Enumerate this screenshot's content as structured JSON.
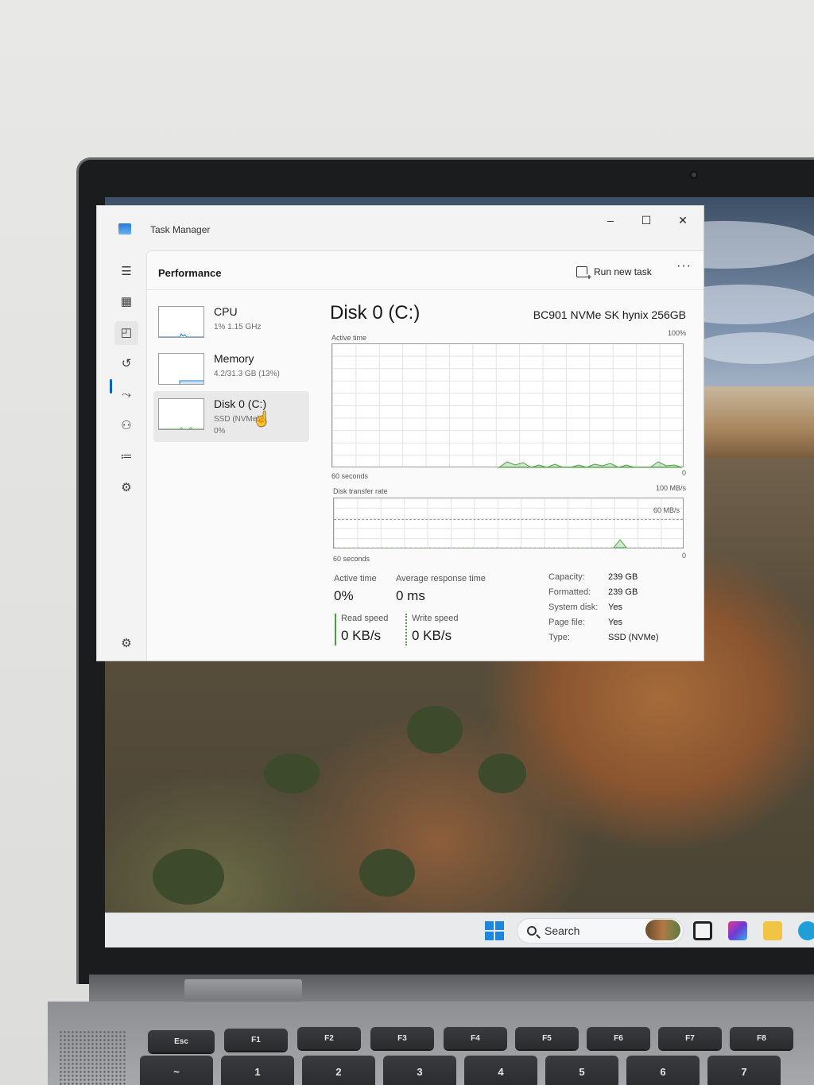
{
  "window": {
    "title": "Task Manager",
    "minimize": "–",
    "maximize": "☐",
    "close": "✕"
  },
  "header": {
    "page_title": "Performance",
    "run_new_task": "Run new task",
    "more": "···"
  },
  "devices": [
    {
      "name": "CPU",
      "sub": "1% 1.15 GHz",
      "sub2": "",
      "color": "#1d7fd6"
    },
    {
      "name": "Memory",
      "sub": "4.2/31.3 GB (13%)",
      "sub2": "",
      "color": "#1d7fd6"
    },
    {
      "name": "Disk 0 (C:)",
      "sub": "SSD (NVMe)",
      "sub2": "0%",
      "color": "#4aa03f"
    }
  ],
  "disk": {
    "title": "Disk 0 (C:)",
    "model": "BC901 NVMe SK hynix 256GB",
    "active_time_graph": {
      "label": "Active time",
      "max": "100%",
      "time_span": "60 seconds",
      "min": "0"
    },
    "transfer_graph": {
      "label": "Disk transfer rate",
      "max": "100 MB/s",
      "inner_max": "60 MB/s",
      "time_span": "60 seconds",
      "min": "0"
    },
    "stats": {
      "active_time_label": "Active time",
      "active_time_value": "0%",
      "response_label": "Average response time",
      "response_value": "0 ms",
      "read_label": "Read speed",
      "read_value": "0 KB/s",
      "write_label": "Write speed",
      "write_value": "0 KB/s"
    },
    "properties": [
      {
        "key": "Capacity:",
        "value": "239 GB"
      },
      {
        "key": "Formatted:",
        "value": "239 GB"
      },
      {
        "key": "System disk:",
        "value": "Yes"
      },
      {
        "key": "Page file:",
        "value": "Yes"
      },
      {
        "key": "Type:",
        "value": "SSD (NVMe)"
      }
    ]
  },
  "taskbar": {
    "search_label": "Search"
  },
  "keyboard": {
    "fn_row": [
      "Esc",
      "F1",
      "F2",
      "F3",
      "F4",
      "F5",
      "F6",
      "F7",
      "F8"
    ],
    "num_row": [
      "~",
      "!",
      "@",
      "#",
      "$",
      "%",
      "^",
      "&"
    ],
    "num_row_sub": [
      "`",
      "1",
      "2",
      "3",
      "4",
      "5",
      "6",
      "7"
    ]
  },
  "colors": {
    "disk_accent": "#4aa03f",
    "cpu_accent": "#1d7fd6",
    "nav_active": "#0a5fc2"
  },
  "icons": {
    "nav": [
      "hamburger-icon",
      "processes-icon",
      "performance-icon",
      "app-history-icon",
      "startup-apps-icon",
      "users-icon",
      "details-icon",
      "services-icon",
      "settings-icon"
    ]
  }
}
